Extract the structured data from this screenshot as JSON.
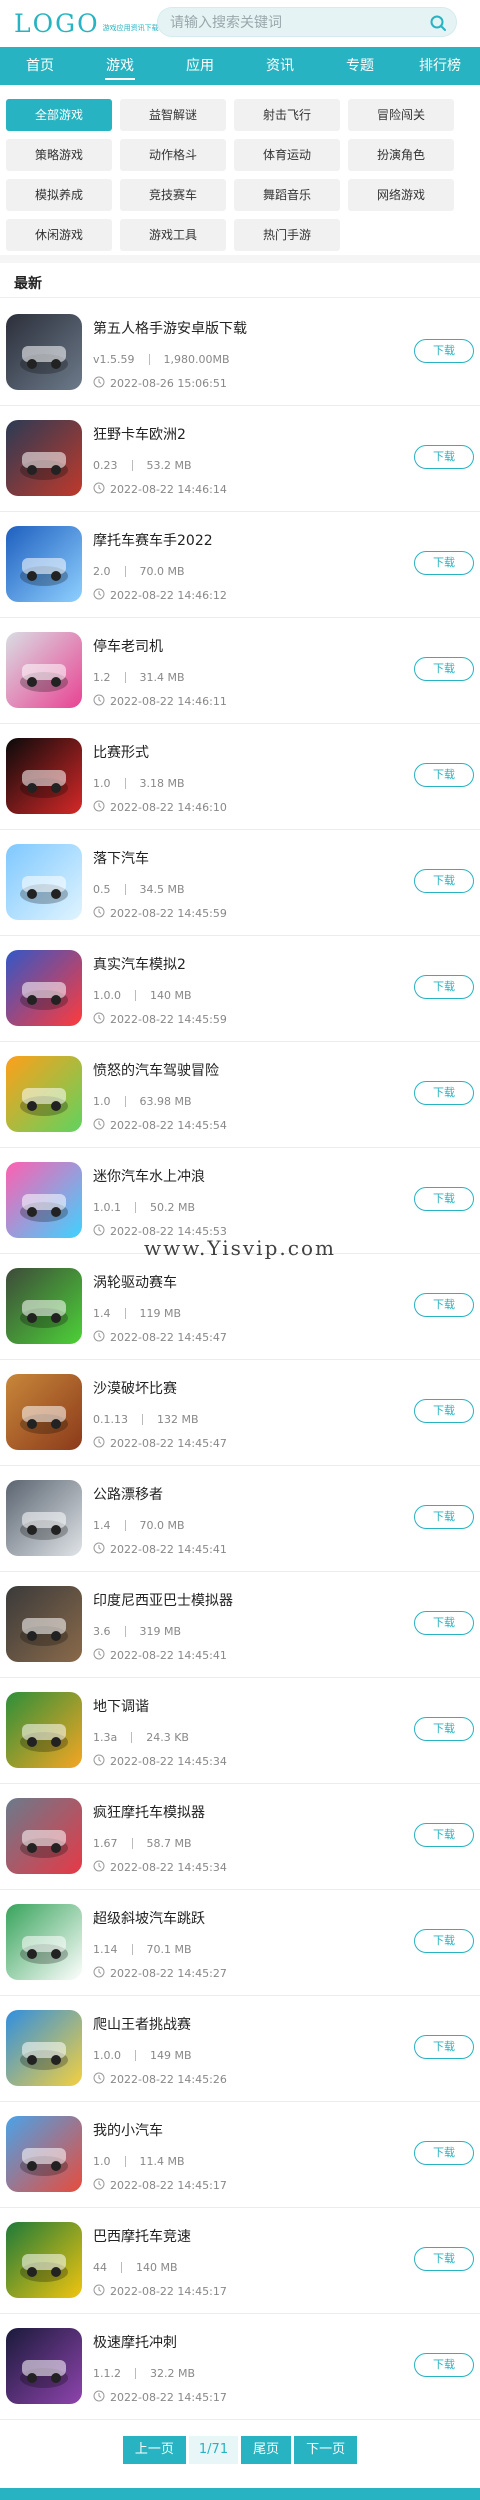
{
  "header": {
    "logo_text": "LOGO",
    "logo_sub": "游戏应用资讯下载",
    "search_placeholder": "请输入搜索关键词"
  },
  "nav": [
    "首页",
    "游戏",
    "应用",
    "资讯",
    "专题",
    "排行榜"
  ],
  "nav_active": 1,
  "categories": [
    "全部游戏",
    "益智解谜",
    "射击飞行",
    "冒险闯关",
    "策略游戏",
    "动作格斗",
    "体育运动",
    "扮演角色",
    "模拟养成",
    "竞技赛车",
    "舞蹈音乐",
    "网络游戏",
    "休闲游戏",
    "游戏工具",
    "热门手游"
  ],
  "category_active": 0,
  "section_title": "最新",
  "download_label": "下载",
  "watermark": "www.Yisvip.com",
  "apps": [
    {
      "name": "第五人格手游安卓版下载",
      "version": "v1.5.59",
      "size": "1,980.00MB",
      "time": "2022-08-26 15:06:51"
    },
    {
      "name": "狂野卡车欧洲2",
      "version": "0.23",
      "size": "53.2 MB",
      "time": "2022-08-22 14:46:14"
    },
    {
      "name": "摩托车赛车手2022",
      "version": "2.0",
      "size": "70.0 MB",
      "time": "2022-08-22 14:46:12"
    },
    {
      "name": "停车老司机",
      "version": "1.2",
      "size": "31.4 MB",
      "time": "2022-08-22 14:46:11"
    },
    {
      "name": "比赛形式",
      "version": "1.0",
      "size": "3.18 MB",
      "time": "2022-08-22 14:46:10"
    },
    {
      "name": "落下汽车",
      "version": "0.5",
      "size": "34.5 MB",
      "time": "2022-08-22 14:45:59"
    },
    {
      "name": "真实汽车模拟2",
      "version": "1.0.0",
      "size": "140 MB",
      "time": "2022-08-22 14:45:59"
    },
    {
      "name": "愤怒的汽车驾驶冒险",
      "version": "1.0",
      "size": "63.98 MB",
      "time": "2022-08-22 14:45:54"
    },
    {
      "name": "迷你汽车水上冲浪",
      "version": "1.0.1",
      "size": "50.2 MB",
      "time": "2022-08-22 14:45:53"
    },
    {
      "name": "涡轮驱动赛车",
      "version": "1.4",
      "size": "119 MB",
      "time": "2022-08-22 14:45:47"
    },
    {
      "name": "沙漠破坏比赛",
      "version": "0.1.13",
      "size": "132 MB",
      "time": "2022-08-22 14:45:47"
    },
    {
      "name": "公路漂移者",
      "version": "1.4",
      "size": "70.0 MB",
      "time": "2022-08-22 14:45:41"
    },
    {
      "name": "印度尼西亚巴士模拟器",
      "version": "3.6",
      "size": "319 MB",
      "time": "2022-08-22 14:45:41"
    },
    {
      "name": "地下调谐",
      "version": "1.3a",
      "size": "24.3 KB",
      "time": "2022-08-22 14:45:34"
    },
    {
      "name": "疯狂摩托车模拟器",
      "version": "1.67",
      "size": "58.7 MB",
      "time": "2022-08-22 14:45:34"
    },
    {
      "name": "超级斜坡汽车跳跃",
      "version": "1.14",
      "size": "70.1 MB",
      "time": "2022-08-22 14:45:27"
    },
    {
      "name": "爬山王者挑战赛",
      "version": "1.0.0",
      "size": "149 MB",
      "time": "2022-08-22 14:45:26"
    },
    {
      "name": "我的小汽车",
      "version": "1.0",
      "size": "11.4 MB",
      "time": "2022-08-22 14:45:17"
    },
    {
      "name": "巴西摩托车竞速",
      "version": "44",
      "size": "140 MB",
      "time": "2022-08-22 14:45:17"
    },
    {
      "name": "极速摩托冲刺",
      "version": "1.1.2",
      "size": "32.2 MB",
      "time": "2022-08-22 14:45:17"
    }
  ],
  "thumb_icons": [
    "horror-character-icon",
    "truck-icon",
    "motorbike-racer-icon",
    "pink-car-icon",
    "forma-race-logo-icon",
    "falling-car-icon",
    "blue-racecar-icon",
    "angry-car-icon",
    "water-surf-car-icon",
    "green-sports-car-icon",
    "desert-car-icon",
    "highway-drift-icon",
    "bus-steering-wheel-icon",
    "tuned-car-icon",
    "crazy-motorbike-icon",
    "ramp-car-jump-icon",
    "hill-climb-car-icon",
    "small-red-car-icon",
    "brazil-motorbike-icon",
    "purple-motorbike-icon"
  ],
  "thumb_colors": [
    [
      "#2b2f3a",
      "#6d7a8a"
    ],
    [
      "#2a3b55",
      "#c0392b"
    ],
    [
      "#1e5fbf",
      "#8fd0ff"
    ],
    [
      "#d9dde3",
      "#e84393"
    ],
    [
      "#0a0a0a",
      "#d62828"
    ],
    [
      "#7ec8ff",
      "#e0f4ff"
    ],
    [
      "#3257c7",
      "#ff3b3b"
    ],
    [
      "#ff9f1a",
      "#5fd35f"
    ],
    [
      "#ff5fb0",
      "#3ed2ff"
    ],
    [
      "#3e4a3a",
      "#4cd137"
    ],
    [
      "#c8873a",
      "#8b3a1a"
    ],
    [
      "#5a6470",
      "#e0e4e8"
    ],
    [
      "#3a3a3a",
      "#8a6a4a"
    ],
    [
      "#2d8f3a",
      "#f5a623"
    ],
    [
      "#6a7b8c",
      "#e63946"
    ],
    [
      "#37a35b",
      "#ffffff"
    ],
    [
      "#2f8fe0",
      "#f4d03f"
    ],
    [
      "#4aa3e8",
      "#e74c3c"
    ],
    [
      "#1e7a3a",
      "#f1c40f"
    ],
    [
      "#1a1a3a",
      "#8e44ad"
    ]
  ],
  "pager": {
    "prev": "上一页",
    "info": "1/71",
    "last": "尾页",
    "next": "下一页"
  },
  "colors": {
    "accent": "#27b3c2",
    "tab_bg": "#f1f1f1"
  }
}
